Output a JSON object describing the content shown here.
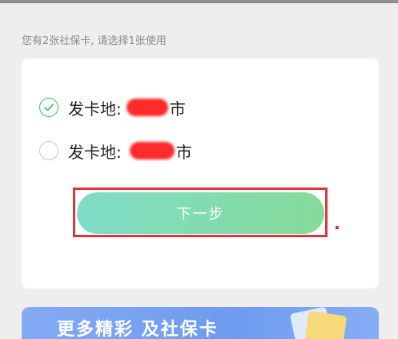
{
  "hint": "您有2张社保卡, 请选择1张使用",
  "cards": [
    {
      "prefix": "发卡地:",
      "suffix": "市",
      "selected": true
    },
    {
      "prefix": "发卡地:",
      "suffix": "市",
      "selected": false
    }
  ],
  "next_button": {
    "label": "下一步"
  },
  "banner": {
    "text": "更多精彩 及社保卡"
  },
  "colors": {
    "accent_green": "#41b86a",
    "button_gradient_start": "#7fdcc7",
    "button_gradient_end": "#86db9a",
    "annotation_red": "#d9363e",
    "redaction_red": "#ff2a2a",
    "banner_blue": "#6e9bef"
  },
  "icons": {
    "selected": "check-circle-icon",
    "unselected": "empty-circle-icon"
  }
}
